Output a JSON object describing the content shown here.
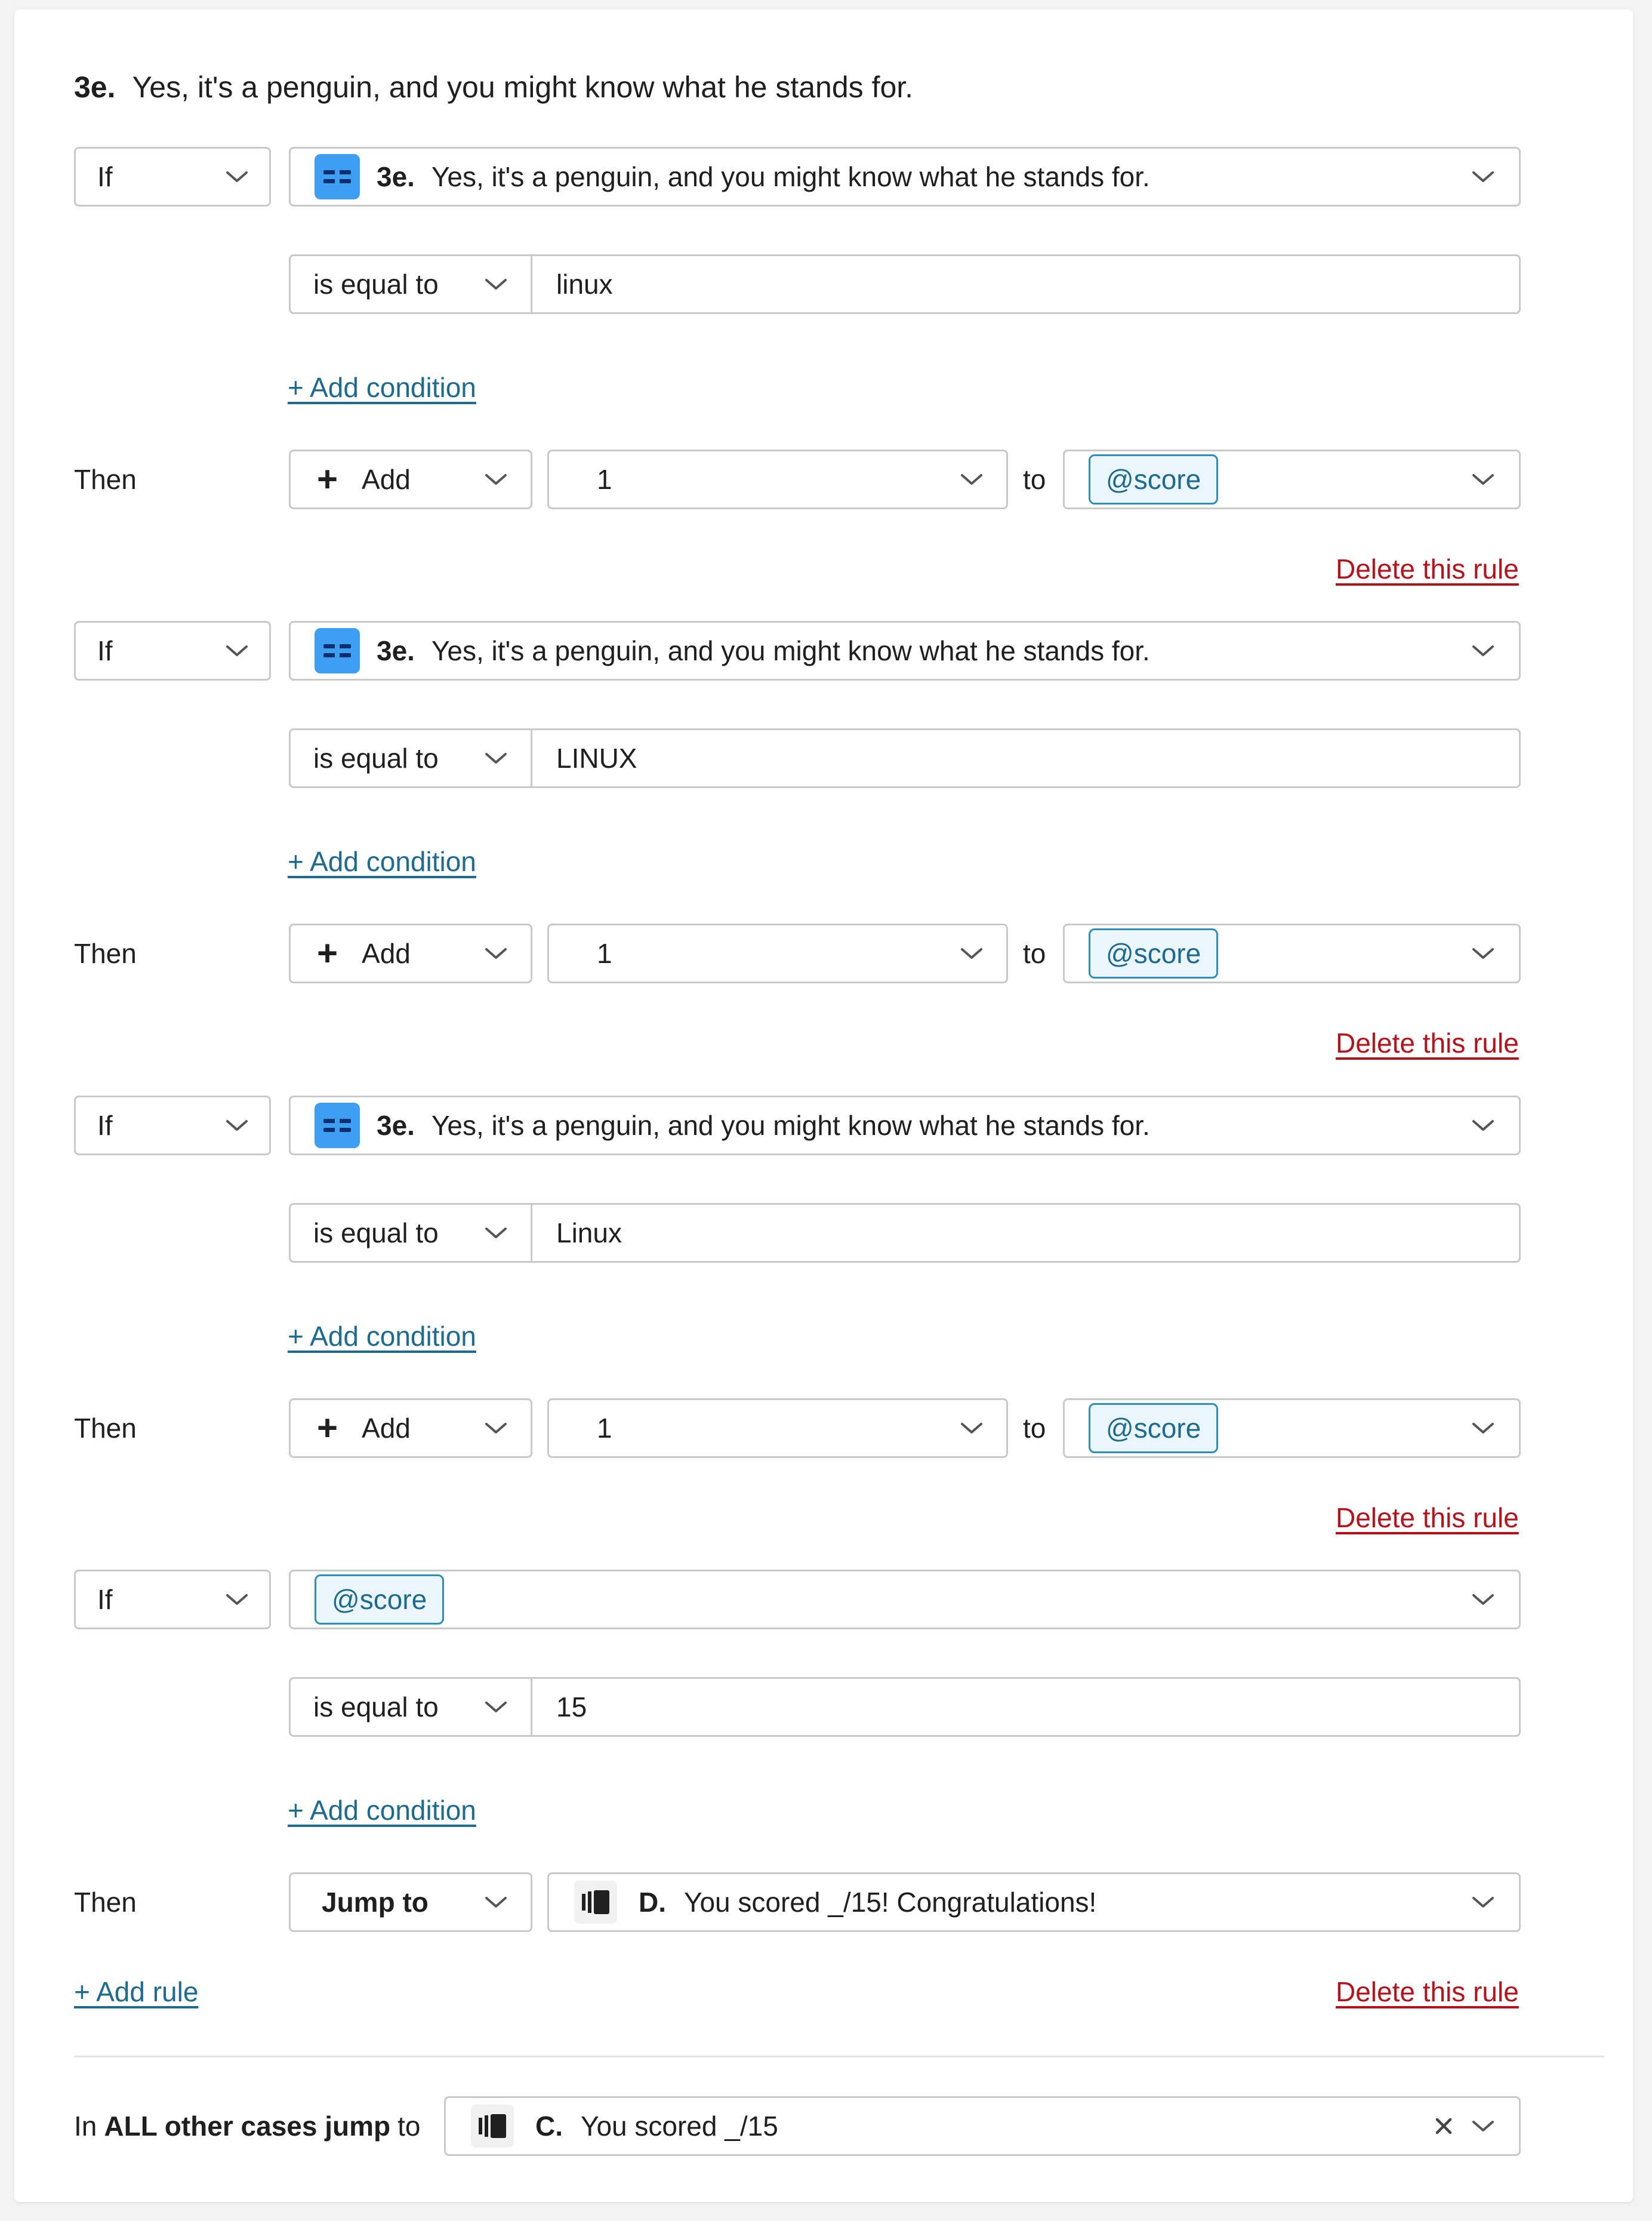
{
  "question": {
    "number": "3e.",
    "text": "Yes, it's a penguin, and you might know what he stands for."
  },
  "rules": [
    {
      "if_label": "If",
      "subject": {
        "kind": "question",
        "number": "3e.",
        "text": "Yes, it's a penguin, and you might know what he stands for."
      },
      "operator": "is equal to",
      "value": "linux",
      "add_condition": "+ Add condition",
      "then_label": "Then",
      "action": {
        "kind": "add",
        "label": "Add",
        "amount": "1",
        "to": "to",
        "variable": "@score"
      },
      "delete": "Delete this rule"
    },
    {
      "if_label": "If",
      "subject": {
        "kind": "question",
        "number": "3e.",
        "text": "Yes, it's a penguin, and you might know what he stands for."
      },
      "operator": "is equal to",
      "value": "LINUX",
      "add_condition": "+ Add condition",
      "then_label": "Then",
      "action": {
        "kind": "add",
        "label": "Add",
        "amount": "1",
        "to": "to",
        "variable": "@score"
      },
      "delete": "Delete this rule"
    },
    {
      "if_label": "If",
      "subject": {
        "kind": "question",
        "number": "3e.",
        "text": "Yes, it's a penguin, and you might know what he stands for."
      },
      "operator": "is equal to",
      "value": "Linux",
      "add_condition": "+ Add condition",
      "then_label": "Then",
      "action": {
        "kind": "add",
        "label": "Add",
        "amount": "1",
        "to": "to",
        "variable": "@score"
      },
      "delete": "Delete this rule"
    },
    {
      "if_label": "If",
      "subject": {
        "kind": "variable",
        "variable": "@score"
      },
      "operator": "is equal to",
      "value": "15",
      "add_condition": "+ Add condition",
      "then_label": "Then",
      "action": {
        "kind": "jump",
        "label": "Jump to",
        "screen_letter": "D.",
        "screen_text": "You scored _/15! Congratulations!"
      },
      "delete": "Delete this rule"
    }
  ],
  "add_rule": "+ Add rule",
  "other_cases": {
    "prefix": "In",
    "emphasis": "ALL other cases jump",
    "suffix": "to",
    "screen_letter": "C.",
    "screen_text": "You scored _/15"
  },
  "icons": {
    "question_type": "short-text-question-icon",
    "screen": "ending-screen-icon",
    "chevron": "chevron-down-icon",
    "clear": "close-icon",
    "plus": "plus-icon"
  },
  "colors": {
    "link": "#1e6b8f",
    "delete_link": "#b5131b",
    "question_icon_bg": "#3d9ef2",
    "variable_pill_border": "#2b8fb8",
    "variable_pill_bg": "#eaf6fb",
    "field_border": "#c9c9c9"
  }
}
